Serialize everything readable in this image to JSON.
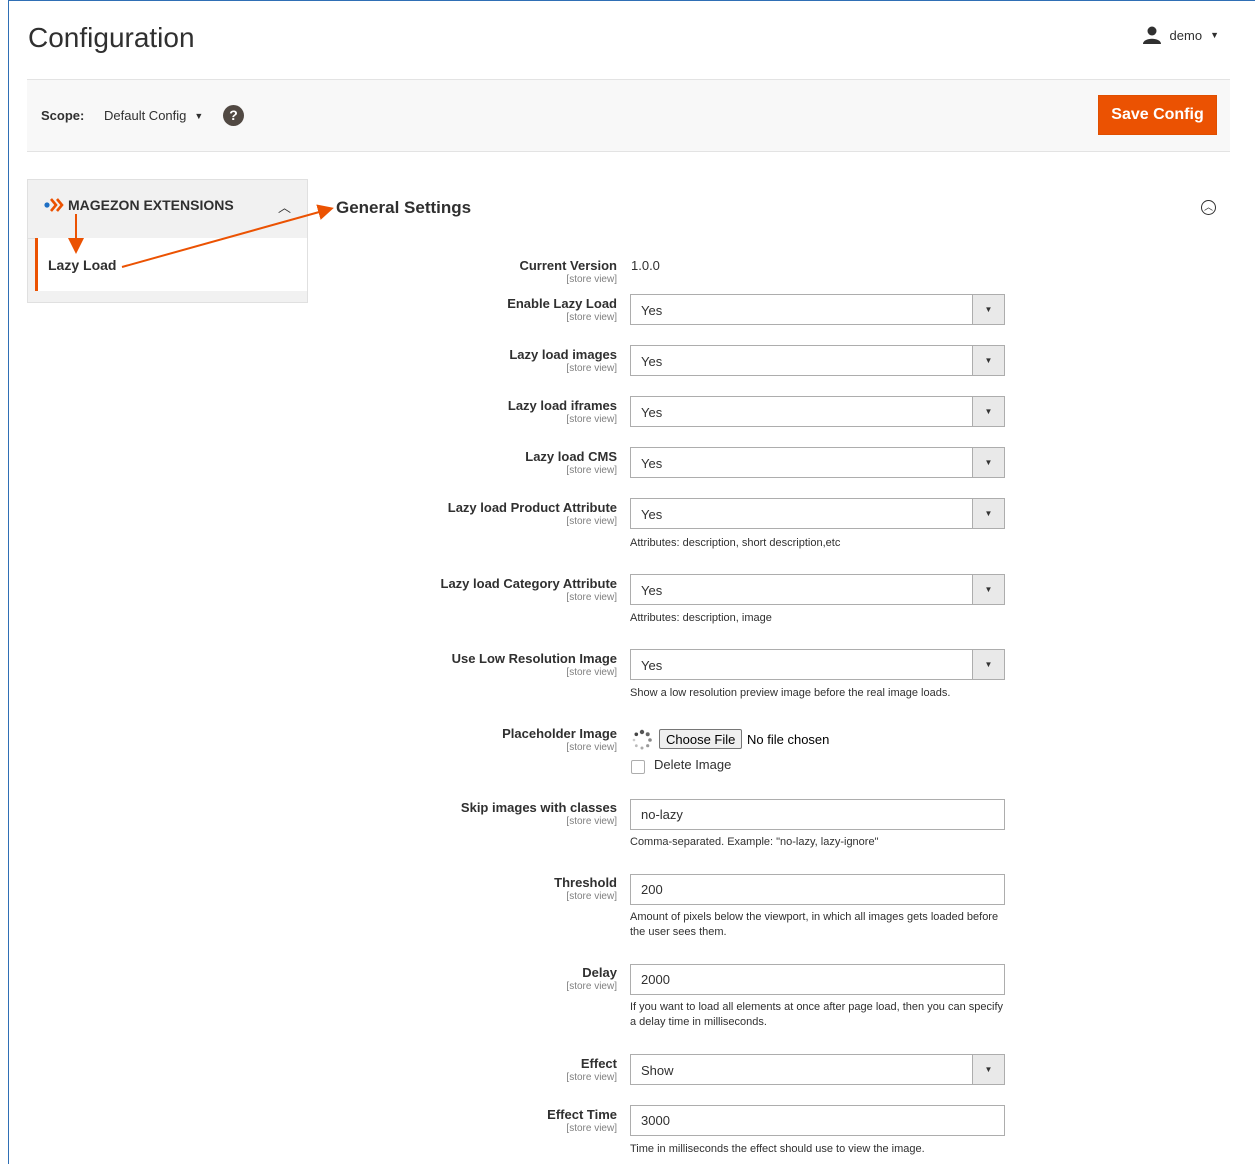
{
  "page": {
    "title": "Configuration"
  },
  "user": {
    "name": "demo"
  },
  "scope": {
    "label": "Scope:",
    "value": "Default Config",
    "help": "?"
  },
  "actions": {
    "save_label": "Save Config"
  },
  "sidebar": {
    "group_title": "MAGEZON EXTENSIONS",
    "items": [
      {
        "label": "Lazy Load"
      }
    ]
  },
  "section": {
    "title": "General Settings"
  },
  "fields": {
    "current_version": {
      "label": "Current Version",
      "scope": "[store view]",
      "value": "1.0.0"
    },
    "enable_lazy_load": {
      "label": "Enable Lazy Load",
      "scope": "[store view]",
      "value": "Yes"
    },
    "lazy_images": {
      "label": "Lazy load images",
      "scope": "[store view]",
      "value": "Yes"
    },
    "lazy_iframes": {
      "label": "Lazy load iframes",
      "scope": "[store view]",
      "value": "Yes"
    },
    "lazy_cms": {
      "label": "Lazy load CMS",
      "scope": "[store view]",
      "value": "Yes"
    },
    "lazy_product_attr": {
      "label": "Lazy load Product Attribute",
      "scope": "[store view]",
      "value": "Yes",
      "note": "Attributes: description, short description,etc"
    },
    "lazy_category_attr": {
      "label": "Lazy load Category Attribute",
      "scope": "[store view]",
      "value": "Yes",
      "note": "Attributes: description, image"
    },
    "low_res": {
      "label": "Use Low Resolution Image",
      "scope": "[store view]",
      "value": "Yes",
      "note": "Show a low resolution preview image before the real image loads."
    },
    "placeholder": {
      "label": "Placeholder Image",
      "scope": "[store view]",
      "choose_label": "Choose File",
      "file_status": "No file chosen",
      "delete_label": "Delete Image"
    },
    "skip_classes": {
      "label": "Skip images with classes",
      "scope": "[store view]",
      "value": "no-lazy",
      "note": "Comma-separated. Example: \"no-lazy, lazy-ignore\""
    },
    "threshold": {
      "label": "Threshold",
      "scope": "[store view]",
      "value": "200",
      "note": "Amount of pixels below the viewport, in which all images gets loaded before the user sees them."
    },
    "delay": {
      "label": "Delay",
      "scope": "[store view]",
      "value": "2000",
      "note": "If you want to load all elements at once after page load, then you can specify a delay time in milliseconds."
    },
    "effect": {
      "label": "Effect",
      "scope": "[store view]",
      "value": "Show"
    },
    "effect_time": {
      "label": "Effect Time",
      "scope": "[store view]",
      "value": "3000",
      "note": "Time in milliseconds the effect should use to view the image."
    }
  },
  "colors": {
    "accent": "#eb5202",
    "frame": "#2f6fb5"
  },
  "icons": {
    "user": "user-icon",
    "help": "help-icon",
    "collapse": "collapse-up-icon",
    "logo": "magezon-logo-icon"
  }
}
